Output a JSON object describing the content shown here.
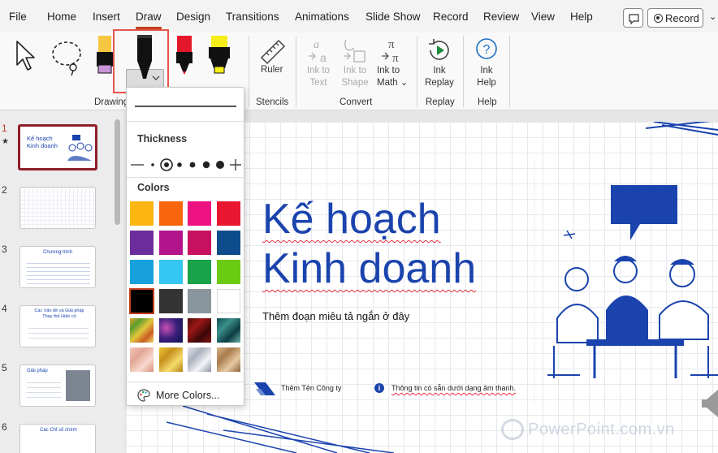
{
  "menu": {
    "tabs": [
      "File",
      "Home",
      "Insert",
      "Draw",
      "Design",
      "Transitions",
      "Animations",
      "Slide Show",
      "Record",
      "Review",
      "View",
      "Help"
    ],
    "active_tab": "Draw",
    "record_label": "Record"
  },
  "ribbon": {
    "groups": {
      "drawing": "Drawing",
      "stencils": "Stencils",
      "convert": "Convert",
      "replay": "Replay",
      "help": "Help"
    },
    "ruler": "Ruler",
    "ink_to_text": [
      "Ink to",
      "Text"
    ],
    "ink_to_shape": [
      "Ink to",
      "Shape"
    ],
    "ink_to_math": [
      "Ink to",
      "Math"
    ],
    "ink_replay": [
      "Ink",
      "Replay"
    ],
    "ink_help": [
      "Ink",
      "Help"
    ]
  },
  "dropdown": {
    "thickness_label": "Thickness",
    "colors_label": "Colors",
    "more_colors": "More Colors...",
    "selected_color": "#000000",
    "swatches": [
      [
        "#fbb614",
        "#f9650d",
        "#ef1281",
        "#e8162f"
      ],
      [
        "#6c2d9d",
        "#b3148c",
        "#c81060",
        "#0e4d8c"
      ],
      [
        "#17a1dc",
        "#35c7f1",
        "#1aa24a",
        "#6bcb13"
      ],
      [
        "#000000",
        "#333333",
        "#8a969e",
        "#ffffff"
      ],
      [
        "texture-gold-multicolor",
        "texture-galaxy",
        "texture-red-marble",
        "texture-teal-marble"
      ],
      [
        "texture-rose-gold",
        "texture-gold",
        "texture-silver",
        "texture-bronze"
      ]
    ]
  },
  "slides": [
    {
      "number": "1",
      "title": "Kế hoạch Kinh doanh",
      "starred": true
    },
    {
      "number": "2"
    },
    {
      "number": "3",
      "title": "Chương trình"
    },
    {
      "number": "4",
      "title": "Các Vấn đề và Giải pháp Thay thế Hiện có"
    },
    {
      "number": "5",
      "title": "Giải pháp"
    },
    {
      "number": "6",
      "title": "Các Chỉ số chính"
    }
  ],
  "slide": {
    "title_line1": "Kế hoạch",
    "title_line2": "Kinh doanh",
    "subtitle": "Thêm đoạn miêu tả ngắn ở đây",
    "company": "Thêm Tên Công ty",
    "info": "Thông tin có sẵn dưới dạng âm thanh.",
    "watermark": "PowerPoint.com.vn"
  }
}
